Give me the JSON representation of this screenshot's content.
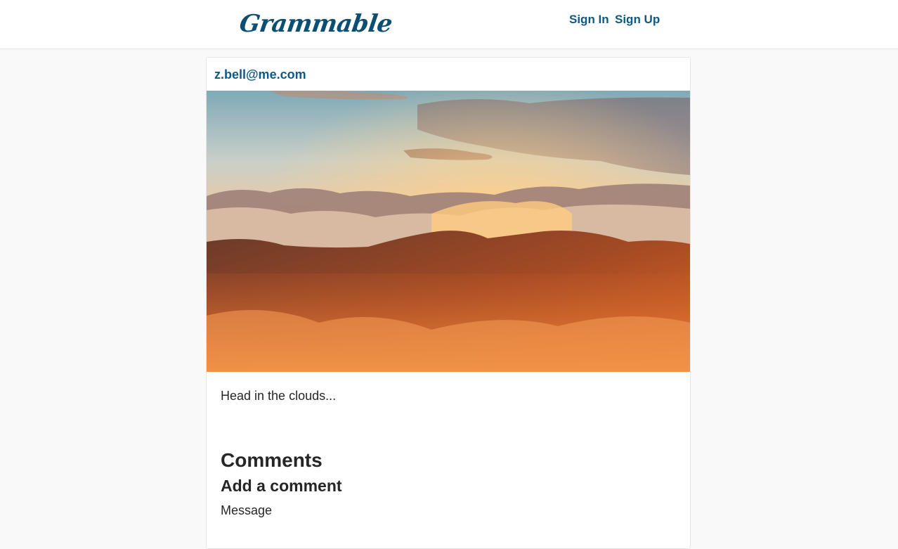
{
  "header": {
    "logo_text": "Grammable",
    "nav": {
      "sign_in": "Sign In",
      "sign_up": "Sign Up"
    }
  },
  "post": {
    "author": "z.bell@me.com",
    "image_description_icon": "mountain-photo",
    "caption": "Head in the clouds...",
    "comments_heading": "Comments",
    "add_comment_heading": "Add a comment",
    "message_label": "Message"
  },
  "colors": {
    "brand": "#0d4f73",
    "link": "#0d5a85",
    "page_bg": "#f9f9f9",
    "text": "#262626"
  }
}
